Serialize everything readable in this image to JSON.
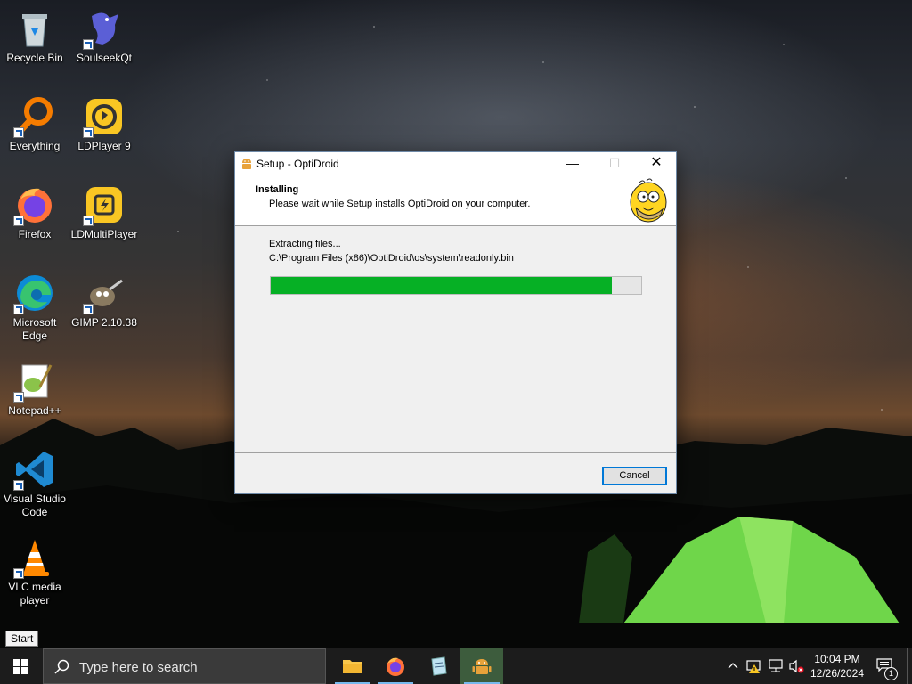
{
  "desktop": {
    "icons": [
      {
        "label": "Recycle Bin"
      },
      {
        "label": "SoulseekQt"
      },
      {
        "label": "Everything"
      },
      {
        "label": "LDPlayer 9"
      },
      {
        "label": "Firefox"
      },
      {
        "label": "LDMultiPlayer"
      },
      {
        "label": "Microsoft Edge"
      },
      {
        "label": "GIMP 2.10.38"
      },
      {
        "label": "Notepad++"
      },
      {
        "label": "Visual Studio Code"
      },
      {
        "label": "VLC media player"
      }
    ]
  },
  "dialog": {
    "title": "Setup - OptiDroid",
    "header_title": "Installing",
    "header_subtitle": "Please wait while Setup installs OptiDroid on your computer.",
    "status": "Extracting files...",
    "current_file": "C:\\Program Files (x86)\\OptiDroid\\os\\system\\readonly.bin",
    "progress_percent": 92,
    "cancel_label": "Cancel",
    "minimize_glyph": "—",
    "maximize_glyph": "☐",
    "close_glyph": "✕"
  },
  "tooltip": {
    "text": "Start"
  },
  "taskbar": {
    "search_placeholder": "Type here to search",
    "apps": [
      "file-explorer",
      "firefox",
      "notepad-plus-plus",
      "optidroid-setup"
    ],
    "time": "10:04 PM",
    "date": "12/26/2024",
    "notification_count": "1"
  },
  "colors": {
    "progress_fill": "#06b025",
    "taskbar": "#1c1c1c",
    "accent": "#0078d7"
  }
}
